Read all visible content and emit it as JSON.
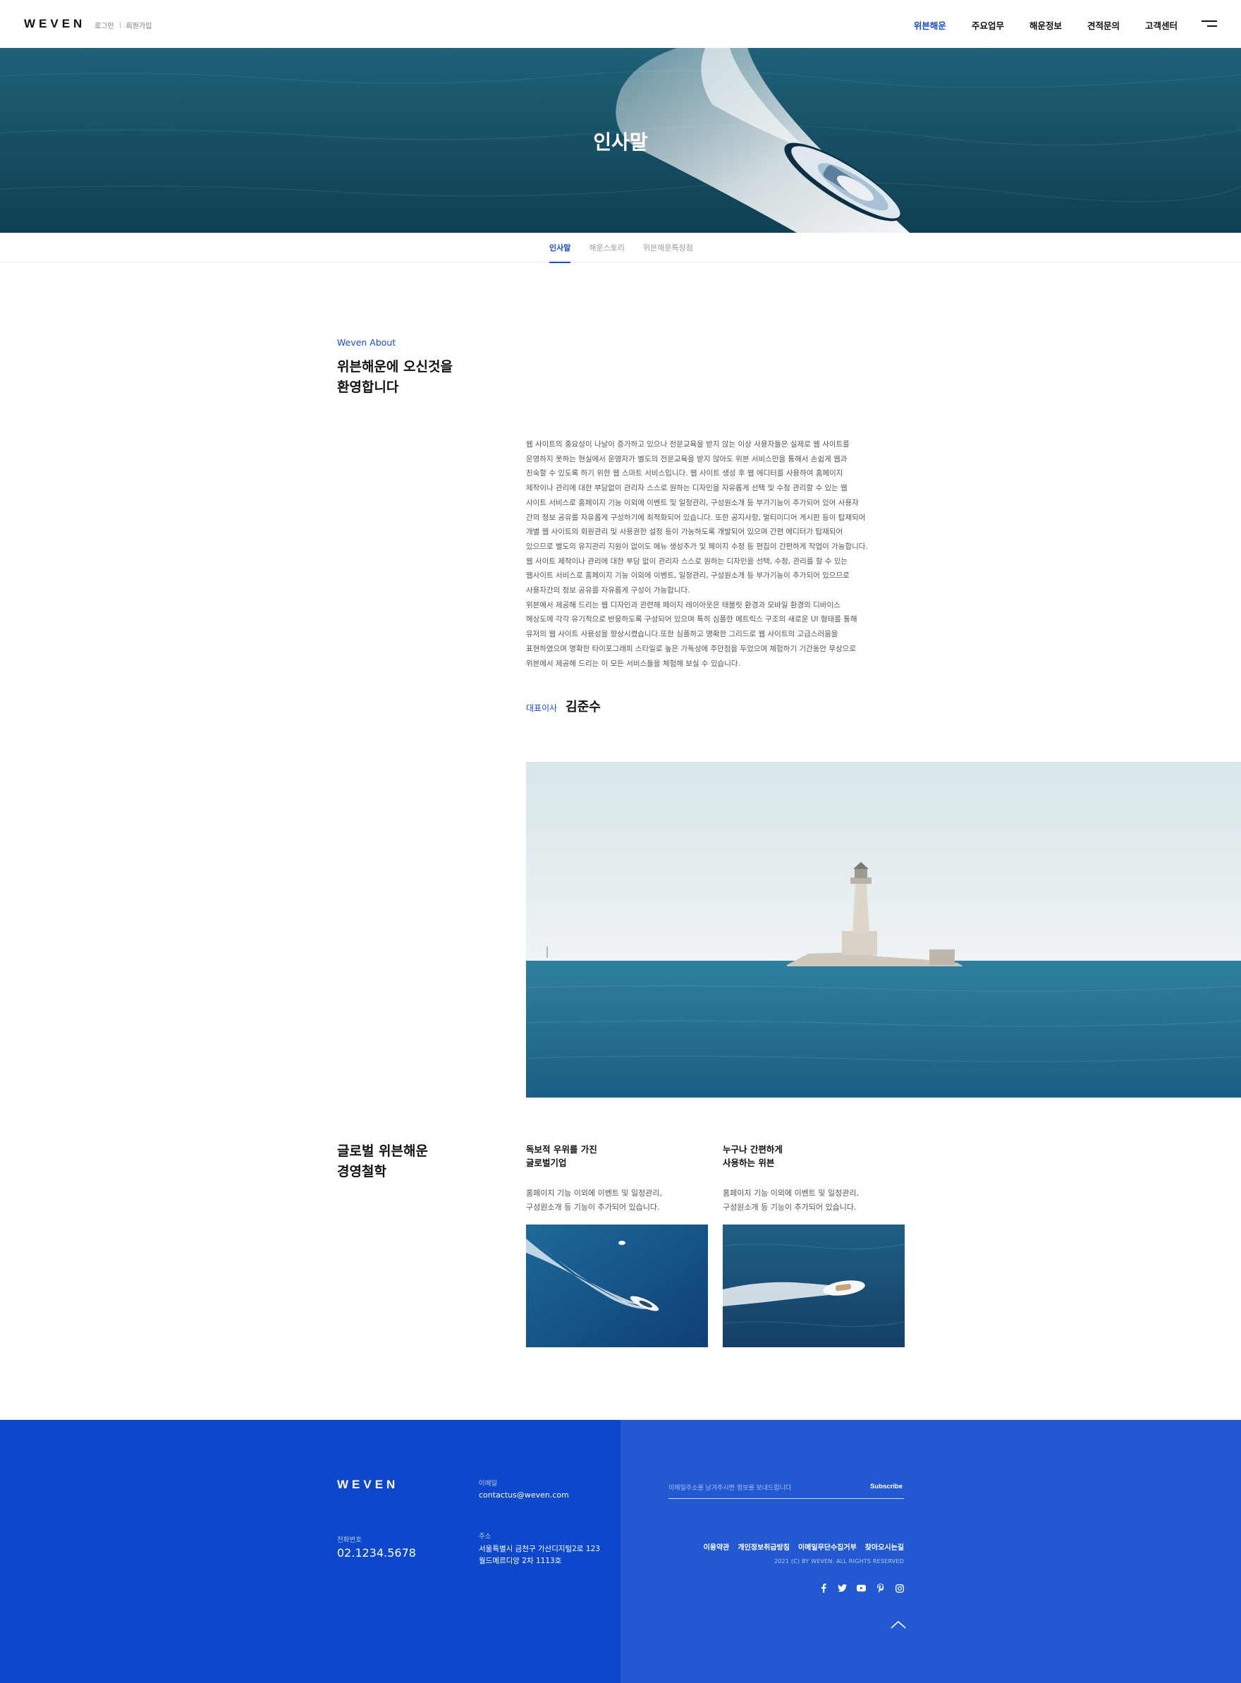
{
  "header": {
    "logo": "WEVEN",
    "util": {
      "login": "로그인",
      "join": "회원가입"
    },
    "nav": [
      {
        "label": "위븐해운",
        "active": true
      },
      {
        "label": "주요업무",
        "active": false
      },
      {
        "label": "해운정보",
        "active": false
      },
      {
        "label": "견적문의",
        "active": false
      },
      {
        "label": "고객센터",
        "active": false
      }
    ],
    "menu_icon": "hamburger-menu-icon"
  },
  "hero": {
    "title": "인사말"
  },
  "subtabs": [
    {
      "label": "인사말",
      "active": true
    },
    {
      "label": "해운스토리",
      "active": false
    },
    {
      "label": "위븐해운특장점",
      "active": false
    }
  ],
  "about": {
    "eyebrow": "Weven About",
    "heading_line1": "위븐해운에 오신것을",
    "heading_line2": "환영합니다",
    "body_lines": [
      "웹 사이트의 중요성이 나날이 증가하고 있으나 전문교육을 받지 않는 이상 사용자들은 실제로 웹 사이트를",
      "운영하지 못하는 현실에서 운영자가 별도의 전문교육을 받지 않아도 위븐 서비스만을 통해서 손쉽게 웹과",
      "친숙할 수 있도록 하기 위한 웹 스마트 서비스입니다. 웹 사이트 생성 후 웹 에디터를 사용하여 홈페이지",
      "제작이나 관리에 대한 부담없이 관리자 스스로 원하는 디자인을 자유롭게 선택 및 수정 관리할 수 있는 웹",
      "사이트 서비스로 홈페이지 기능 이외에 이벤트 및 일정관리, 구성원소개 등 부가기능이 추가되어 있어 사용자",
      "간의 정보 공유를 자유롭게 구성하기에 최적화되어 있습니다. 또한 공지사항, 멀티미디어 게시판 등이 탑재되어",
      "개별 웹 사이트의 회원관리 및 사용권한 설정 등이 가능하도록 개발되어 있으며 간편 에디터가 탑재되어",
      "있으므로 별도의 유지관리 지원이 없이도 메뉴 생성추가 및 페이지 수정 등 편집이 간편하게 작업이 가능합니다.",
      "웹 사이트 제작이나 관리에 대한 부담 없이 관리자 스스로 원하는 디자인을 선택, 수정, 관리를 할 수 있는",
      "웹사이트 서비스로 홈페이지 기능 이외에 이벤트, 일정관리, 구성원소개 등 부가기능이 추가되어 있으므로",
      "사용자간의 정보 공유를 자유롭게 구성이 가능합니다.",
      "위븐에서 제공해 드리는 웹 디자인과 관련해 페이지 레이아웃은 태블릿 환경과 모바일 환경의 디바이스",
      "해상도에 각각 유기적으로 반응하도록 구성되어 있으며 특히 심플한 메트릭스 구조의 새로운 UI 형태를 통해",
      "유저의 웹 사이트 사용성을 향상시켰습니다.또한 심플하고 명확한 그리드로 웹 사이트의 고급스러움을",
      "표현하였으며 명확한 타이포그래피 스타일로 높은 가독성에 주안점을 두었으며 체험하기 기간동안 무상으로",
      "위븐에서 제공해 드리는 이 모든 서비스들을 체험해 보실 수 있습니다."
    ],
    "ceo_role": "대표이사",
    "ceo_name": "김준수"
  },
  "philosophy": {
    "heading_line1": "글로벌 위븐해운",
    "heading_line2": "경영철학",
    "features": [
      {
        "title_line1": "독보적 우위를 가진",
        "title_line2": "글로벌기업",
        "desc_line1": "홈페이지 기능 이외에 이벤트 및 일정관리,",
        "desc_line2": "구성원소개 등 기능이 추가되어 있습니다."
      },
      {
        "title_line1": "누구나 간편하게",
        "title_line2": "사용하는 위븐",
        "desc_line1": "홈페이지 기능 이외에 이벤트 및 일정관리,",
        "desc_line2": "구성원소개 등 기능이 추가되어 있습니다."
      }
    ]
  },
  "footer": {
    "logo": "WEVEN",
    "email_label": "이메일",
    "email": "contactus@weven.com",
    "phone_label": "전화번호",
    "phone": "02.1234.5678",
    "address_label": "주소",
    "address_line1": "서울특별시 금천구 가산디지털2로 123",
    "address_line2": "월드메르디앙 2차 1113호",
    "subscribe_placeholder": "이메일주소를 남겨주시면 정보를 보내드립니다",
    "subscribe_button": "Subscribe",
    "links": [
      "이용약관",
      "개인정보취급방침",
      "이메일무단수집거부",
      "찾아오시는길"
    ],
    "copyright": "2021 (C) BY WEVEN. ALL RIGHTS RESERVED",
    "social_icons": [
      "facebook-icon",
      "twitter-icon",
      "youtube-icon",
      "pinterest-icon",
      "instagram-icon"
    ]
  },
  "colors": {
    "accent": "#1a4bd1",
    "footer_left": "#0d47cc",
    "footer_right": "#2259d3"
  }
}
